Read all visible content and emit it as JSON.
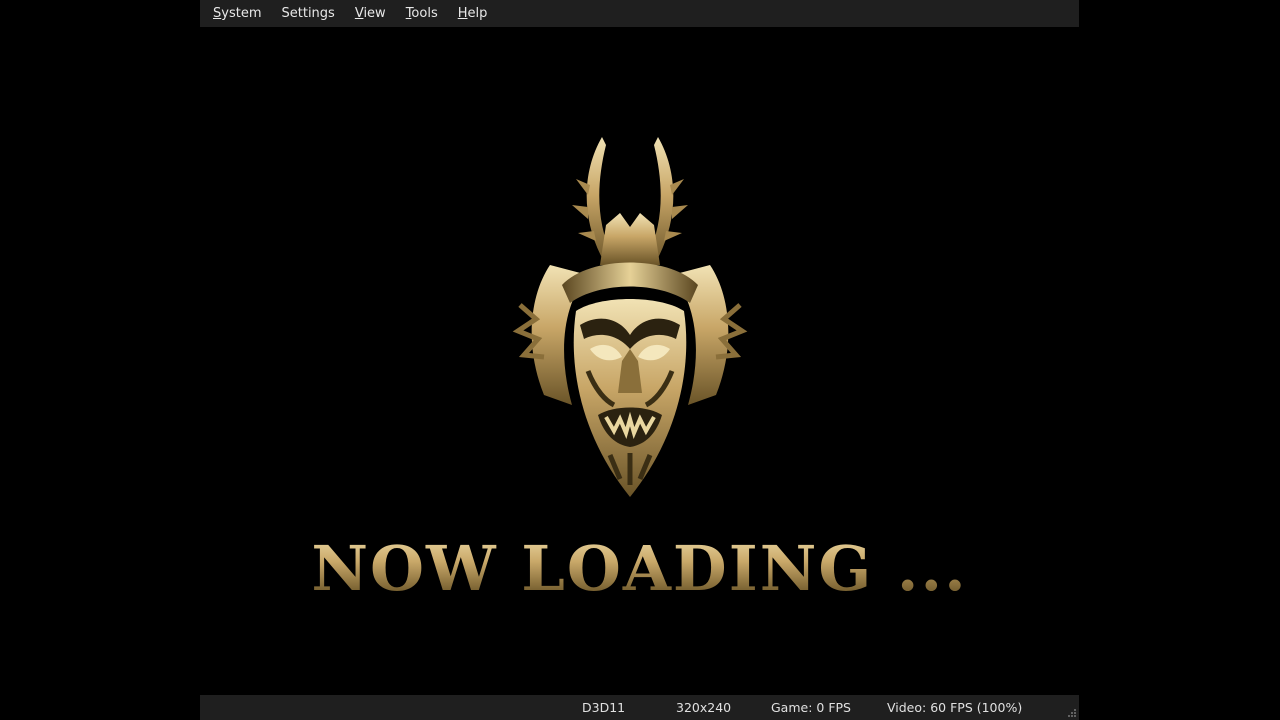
{
  "menu": {
    "items": [
      {
        "label": "System",
        "underline": "S",
        "rest": "ystem"
      },
      {
        "label": "Settings",
        "underline": "",
        "rest": "Settings"
      },
      {
        "label": "View",
        "underline": "V",
        "rest": "iew"
      },
      {
        "label": "Tools",
        "underline": "T",
        "rest": "ools"
      },
      {
        "label": "Help",
        "underline": "H",
        "rest": "elp"
      }
    ]
  },
  "screen": {
    "loading_text": "NOW LOADING ..."
  },
  "status": {
    "renderer": "D3D11",
    "resolution": "320x240",
    "game_fps": "Game: 0 FPS",
    "video_fps": "Video: 60 FPS (100%)"
  },
  "icons": {
    "emblem": "demon-mask-icon",
    "grip": "resize-grip-icon"
  },
  "colors": {
    "menubar": "#1f1f1f",
    "gold": "#caa96a"
  }
}
